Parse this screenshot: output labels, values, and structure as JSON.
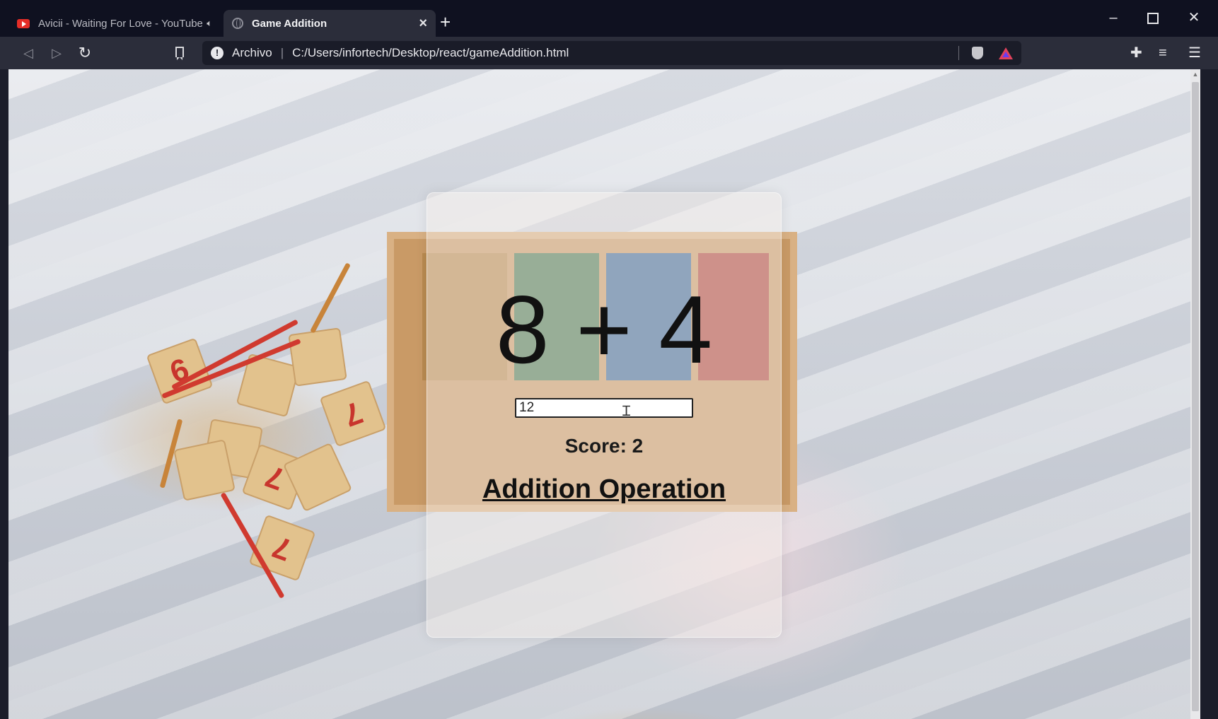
{
  "browser": {
    "tabs": [
      {
        "title": "Avicii - Waiting For Love - YouTube",
        "active": false,
        "icon": "youtube-icon"
      },
      {
        "title": "Game Addition",
        "active": true,
        "icon": "globe-icon"
      }
    ],
    "new_tab_symbol": "+",
    "address": {
      "scheme": "Archivo",
      "separator": "|",
      "url": "C:/Users/infortech/Desktop/react/gameAddition.html"
    }
  },
  "game": {
    "expression": "8 + 4",
    "answer_value": "12",
    "score_text": "Score: 2",
    "operation_title": "Addition Operation"
  },
  "decor": {
    "block_digits": [
      "6",
      "7",
      "7",
      "7"
    ]
  }
}
